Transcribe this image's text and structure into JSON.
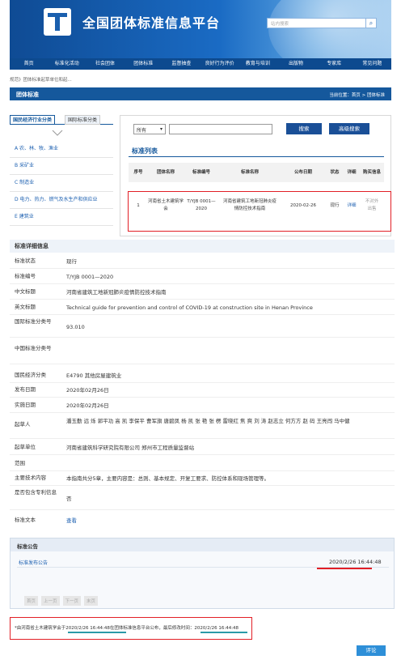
{
  "header": {
    "site_title": "全国团体标准信息平台",
    "search_placeholder": "站内搜索",
    "search_icon": "magnifier-icon",
    "nav": [
      "首页",
      "标准化活动",
      "社会团体",
      "团体标准",
      "监督抽查",
      "良好行为评价",
      "教育与培训",
      "出版物",
      "专家库",
      "常见问题"
    ]
  },
  "breadcrumb_top": "规范》团体标准起草单位和起...",
  "section": {
    "title": "团体标准",
    "position": "当前位置：首页 > 团体标准"
  },
  "left": {
    "tabs": [
      "国民经济行业分类",
      "国际标准分类"
    ],
    "items": [
      "A 农、林、牧、渔业",
      "B 采矿业",
      "C 制造业",
      "D 电力、热力、燃气及水生产和供应业",
      "E 建筑业"
    ]
  },
  "search": {
    "select_value": "所有",
    "search_btn": "搜索",
    "advanced_btn": "高级搜索"
  },
  "list": {
    "title": "标准列表",
    "headers": [
      "序号",
      "团体名称",
      "标准编号",
      "标准名称",
      "公布日期",
      "状态",
      "详细",
      "购买信息"
    ],
    "row": {
      "no": "1",
      "org": "河南省土木建筑学会",
      "code": "T/YJB 0001—2020",
      "name": "河南省建筑工地新冠肺炎疫情防控技术指南",
      "date": "2020-02-26",
      "status": "现行",
      "detail": "详细",
      "buy": "不对外出售"
    }
  },
  "detail": {
    "heading": "标准详细信息",
    "rows": [
      {
        "k": "标准状态",
        "v": "现行"
      },
      {
        "k": "标准编号",
        "v": "T/YJB 0001—2020"
      },
      {
        "k": "中文标题",
        "v": "河南省建筑工地新冠肺炎疫情防控技术指南"
      },
      {
        "k": "英文标题",
        "v": "Technical guide for prevention and control of COVID-19 at construction site in Henan Province"
      },
      {
        "k": "国际标准分类号",
        "v": "93.010"
      },
      {
        "k": "中国标准分类号",
        "v": ""
      },
      {
        "k": "国民经济分类",
        "v": "E4790 其他房屋建筑业"
      },
      {
        "k": "发布日期",
        "v": "2020年02月26日"
      },
      {
        "k": "实施日期",
        "v": "2020年02月26日"
      },
      {
        "k": "起草人",
        "v": "潘玉勤 远 烁 郭平功 高 凯 李保平 曹军旗 唐碧凤 杨 凯 张 艳 张 楞 雷晓红 焦 爽 刘 涛 赵志立 何方方 赵 码 王亮闯 马中健"
      },
      {
        "k": "起草单位",
        "v": "河南省建筑科学研究院有限公司 郑州市工程质量监督站"
      },
      {
        "k": "范围",
        "v": ""
      },
      {
        "k": "主要技术内容",
        "v": "本指南共分5章，主要内容是：总则、基本规定、开复工要求、防控体系和现场管理等。"
      },
      {
        "k": "是否包含专利信息",
        "v": "否"
      },
      {
        "k": "标准文本",
        "v": "查看"
      }
    ]
  },
  "announcement": {
    "heading": "标准公告",
    "link": "标准发布公告",
    "date": "2020/2/26 16:44:48",
    "pager": [
      "首页",
      "上一页",
      "下一页",
      "末页"
    ]
  },
  "footer_note": "*由河南省土木建筑学会于2020/2/26 16:44:48在团体标准信息平台公布，最后修改时间：2020/2/26 16:44:48",
  "comment_btn": "评论",
  "colors": {
    "brand": "#15589c",
    "highlight": "#e21f26",
    "link": "#1b5fb0"
  }
}
